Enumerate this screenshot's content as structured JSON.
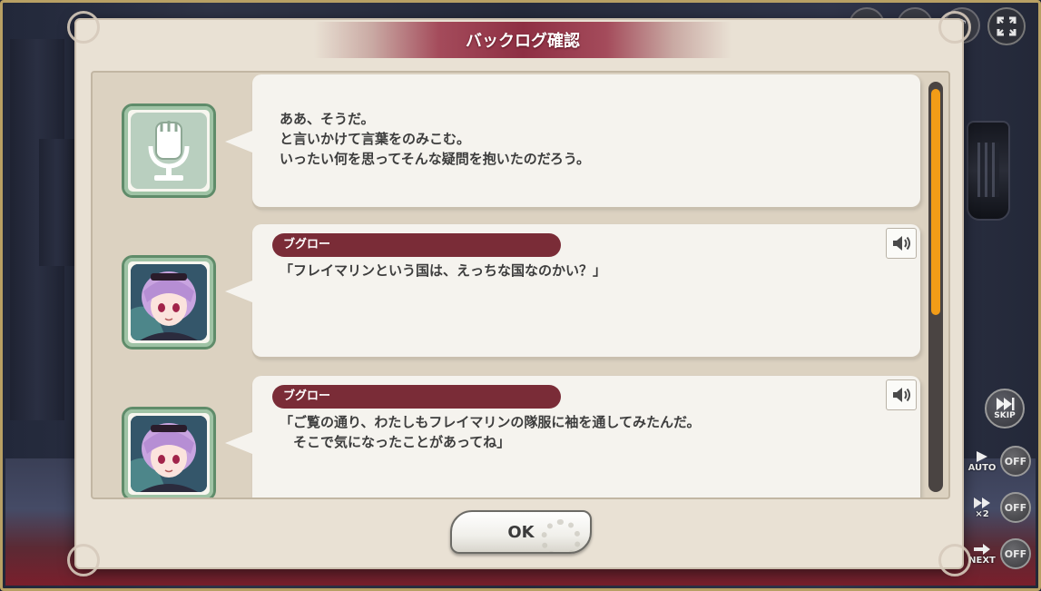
{
  "dialog": {
    "title": "バックログ確認",
    "ok_label": "OK"
  },
  "entries": [
    {
      "type": "narration",
      "avatar_icon": "microphone-icon",
      "speaker": "",
      "lines": "ああ、そうだ。\nと言いかけて言葉をのみこむ。\nいったい何を思ってそんな疑問を抱いたのだろう。",
      "has_voice": false
    },
    {
      "type": "dialogue",
      "avatar_icon": "character-portrait",
      "speaker": "ブグロー",
      "lines": "「フレイマリンという国は、えっちな国なのかい？」",
      "has_voice": true
    },
    {
      "type": "dialogue",
      "avatar_icon": "character-portrait",
      "speaker": "ブグロー",
      "lines": "「ご覧の通り、わたしもフレイマリンの隊服に袖を通してみたんだ。\n　そこで気になったことがあってね」",
      "has_voice": true
    }
  ],
  "scroll": {
    "position_fraction": 0.0,
    "visible_fraction": 0.57
  },
  "side_controls": {
    "skip_label": "SKIP",
    "auto_label": "AUTO",
    "auto_state": "OFF",
    "speed_label": "×2",
    "speed_state": "OFF",
    "next_label": "NEXT",
    "next_state": "OFF"
  },
  "colors": {
    "accent_orange": "#f29c17",
    "speaker_bg": "#7a2c37",
    "title_bg": "#8e2f43",
    "frame_green": "#5f8c6a"
  }
}
